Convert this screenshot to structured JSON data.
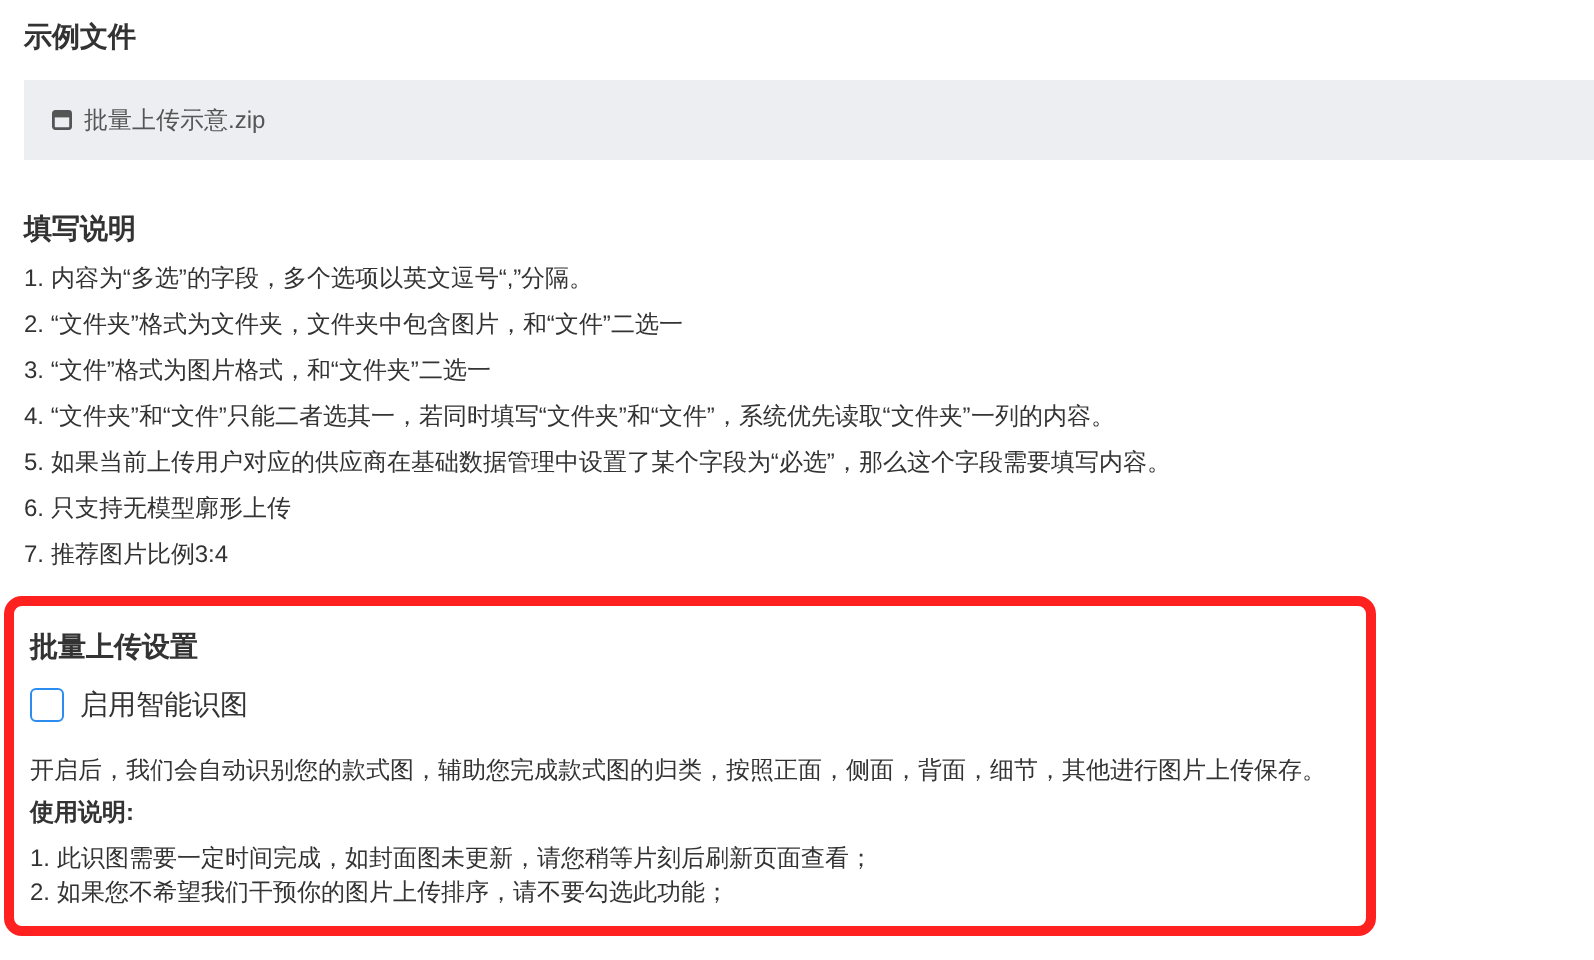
{
  "sample_section": {
    "title": "示例文件",
    "file": {
      "name": "批量上传示意.zip"
    }
  },
  "instructions": {
    "title": "填写说明",
    "items": [
      "1. 内容为“多选”的字段，多个选项以英文逗号“,”分隔。",
      "2. “文件夹”格式为文件夹，文件夹中包含图片，和“文件”二选一",
      "3. “文件”格式为图片格式，和“文件夹”二选一",
      "4. “文件夹”和“文件”只能二者选其一，若同时填写“文件夹”和“文件”，系统优先读取“文件夹”一列的内容。",
      "5. 如果当前上传用户对应的供应商在基础数据管理中设置了某个字段为“必选”，那么这个字段需要填写内容。",
      "6. 只支持无模型廓形上传",
      "7. 推荐图片比例3:4"
    ]
  },
  "upload_settings": {
    "highlighted": true,
    "title": "批量上传设置",
    "checkbox": {
      "label": "启用智能识图",
      "checked": false
    },
    "description": "开启后，我们会自动识别您的款式图，辅助您完成款式图的归类，按照正面，侧面，背面，细节，其他进行图片上传保存。",
    "usage_title": "使用说明:",
    "usage_items": [
      "1. 此识图需要一定时间完成，如封面图未更新，请您稍等片刻后刷新页面查看；",
      "2. 如果您不希望我们干预你的图片上传排序，请不要勾选此功能；"
    ]
  }
}
